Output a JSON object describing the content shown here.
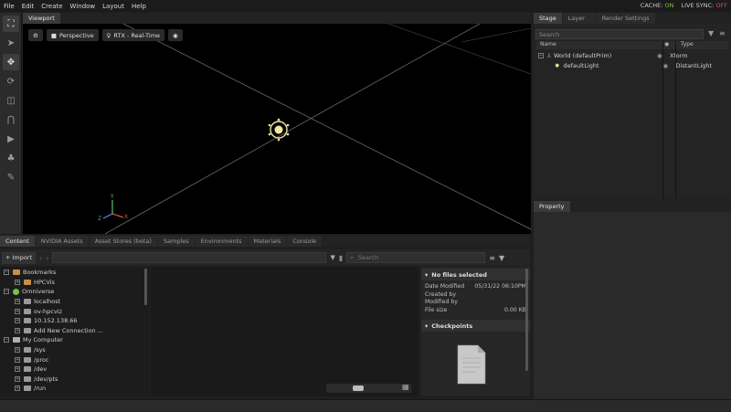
{
  "menubar": {
    "items": [
      "File",
      "Edit",
      "Create",
      "Window",
      "Layout",
      "Help"
    ],
    "cache_label": "CACHE:",
    "cache_value": "ON",
    "livesync_label": "LIVE SYNC:",
    "livesync_value": "OFF"
  },
  "viewport": {
    "tab": "Viewport",
    "camera": "Perspective",
    "renderer": "RTX - Real-Time",
    "axis_x": "X",
    "axis_y": "Y",
    "axis_z": "Z"
  },
  "stage": {
    "tabs": [
      "Stage",
      "Layer",
      "Render Settings"
    ],
    "search_placeholder": "Search",
    "col_name": "Name",
    "col_type": "Type",
    "rows": [
      {
        "name": "World (defaultPrim)",
        "type": "Xform"
      },
      {
        "name": "defaultLight",
        "type": "DistantLight"
      }
    ]
  },
  "property": {
    "tab": "Property"
  },
  "content": {
    "tabs": [
      "Content",
      "NVIDIA Assets",
      "Asset Stores (beta)",
      "Samples",
      "Environments",
      "Materials",
      "Console"
    ],
    "import_label": "Import",
    "search_placeholder": "Search",
    "tree": [
      {
        "label": "Bookmarks",
        "level": 0,
        "icon": "bookmark"
      },
      {
        "label": "HPCVis",
        "level": 1,
        "icon": "folder"
      },
      {
        "label": "Omniverse",
        "level": 0,
        "icon": "omniverse"
      },
      {
        "label": "localhost",
        "level": 1,
        "icon": "server"
      },
      {
        "label": "ov-hpcviz",
        "level": 1,
        "icon": "server"
      },
      {
        "label": "10.152.138.66",
        "level": 1,
        "icon": "server"
      },
      {
        "label": "Add New Connection ...",
        "level": 1,
        "icon": "server"
      },
      {
        "label": "My Computer",
        "level": 0,
        "icon": "computer"
      },
      {
        "label": "/sys",
        "level": 1,
        "icon": "drive"
      },
      {
        "label": "/proc",
        "level": 1,
        "icon": "drive"
      },
      {
        "label": "/dev",
        "level": 1,
        "icon": "drive"
      },
      {
        "label": "/dev/pts",
        "level": 1,
        "icon": "drive"
      },
      {
        "label": "/run",
        "level": 1,
        "icon": "drive"
      }
    ],
    "details": {
      "header": "No files selected",
      "date_modified_label": "Date Modified",
      "date_modified_value": "05/31/22 06:10PM",
      "created_by_label": "Created by",
      "modified_by_label": "Modified by",
      "file_size_label": "File size",
      "file_size_value": "0.00 KB",
      "checkpoints_label": "Checkpoints"
    }
  },
  "colors": {
    "accent_on": "#76c442",
    "accent_off": "#d9534f",
    "light_gizmo": "#f2e6a0",
    "grid_line": "#6b6b6b"
  }
}
